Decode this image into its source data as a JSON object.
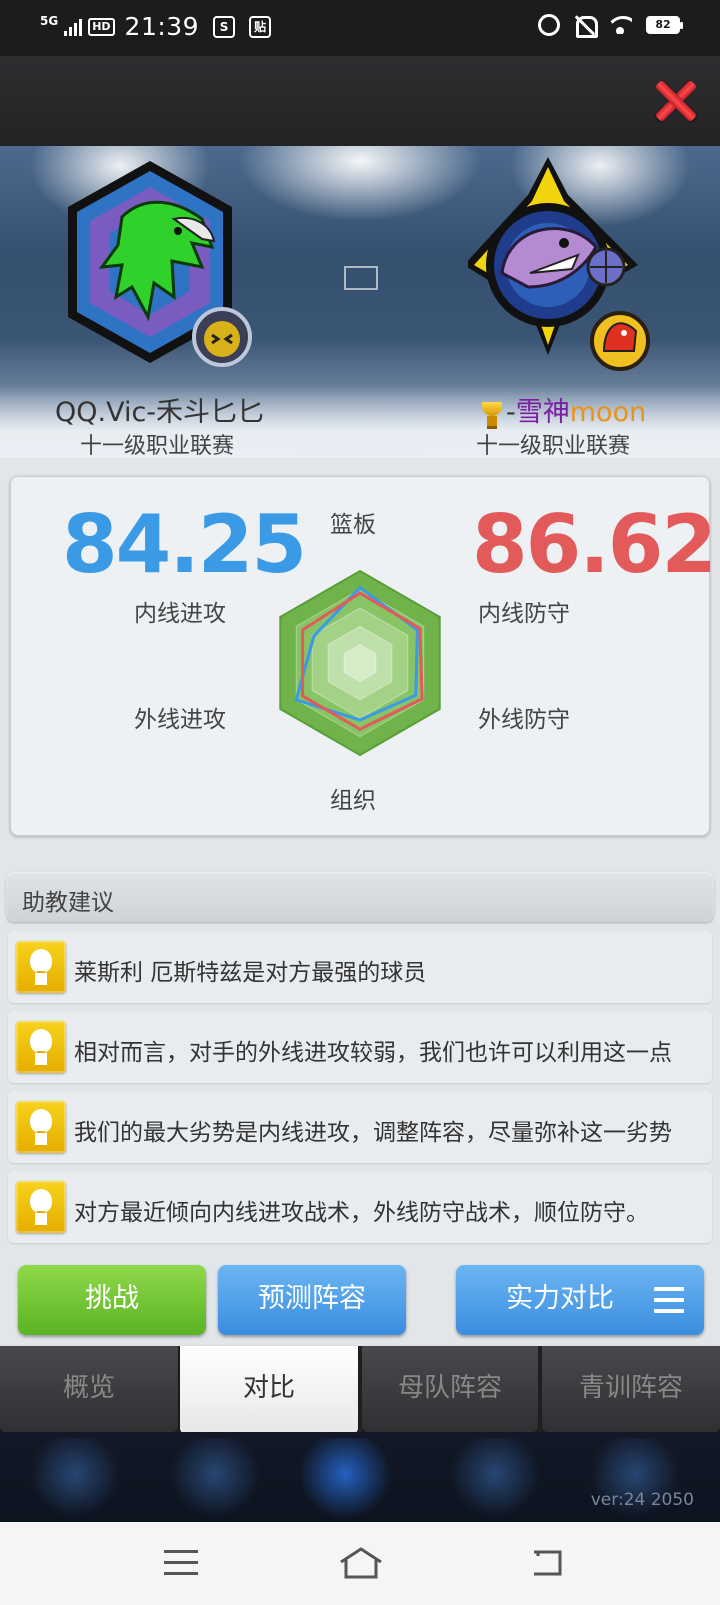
{
  "status_bar": {
    "network": "5G",
    "hd_label": "HD",
    "time": "21:39",
    "app_icon_1": "S",
    "app_icon_2": "贴",
    "battery": "82",
    "icons": [
      "signal-icon",
      "alarm-icon",
      "mute-bell-icon",
      "wifi-icon",
      "battery-icon"
    ]
  },
  "header": {
    "close_icon": "close-icon"
  },
  "teams": {
    "left": {
      "name": "QQ.Vic-禾斗匕匕",
      "league": "十一级职业联赛",
      "score": "84.25",
      "color": "#3a9ae6",
      "logo_icon": "eagle-hexagon-logo-icon"
    },
    "right": {
      "name_prefix": "-",
      "name_main": "雪神",
      "name_suffix": "moon",
      "league": "十一级职业联赛",
      "score": "86.62",
      "color": "#e25a5a",
      "logo_icon": "shark-basketball-logo-icon"
    }
  },
  "radar": {
    "axes": [
      "篮板",
      "内线防守",
      "外线防守",
      "组织",
      "外线进攻",
      "内线进攻"
    ],
    "labels": {
      "top": "篮板",
      "right_upper": "内线防守",
      "right_lower": "外线防守",
      "bottom": "组织",
      "left_lower": "外线进攻",
      "left_upper": "内线进攻"
    },
    "left_team_values": [
      0.82,
      0.72,
      0.7,
      0.62,
      0.8,
      0.58
    ],
    "right_team_values": [
      0.76,
      0.75,
      0.78,
      0.72,
      0.72,
      0.72
    ]
  },
  "advice": {
    "title": "助教建议",
    "tips": [
      "莱斯利 厄斯特兹是对方最强的球员",
      "相对而言，对手的外线进攻较弱，我们也许可以利用这一点",
      "我们的最大劣势是内线进攻，调整阵容，尽量弥补这一劣势",
      "对方最近倾向内线进攻战术，外线防守战术，顺位防守。"
    ]
  },
  "actions": {
    "challenge": "挑战",
    "predict_lineup": "预测阵容",
    "strength_compare": "实力对比"
  },
  "tabs": [
    {
      "label": "概览",
      "active": false
    },
    {
      "label": "对比",
      "active": true
    },
    {
      "label": "母队阵容",
      "active": false
    },
    {
      "label": "青训阵容",
      "active": false
    }
  ],
  "dock": {
    "version": "ver:24  2050"
  }
}
